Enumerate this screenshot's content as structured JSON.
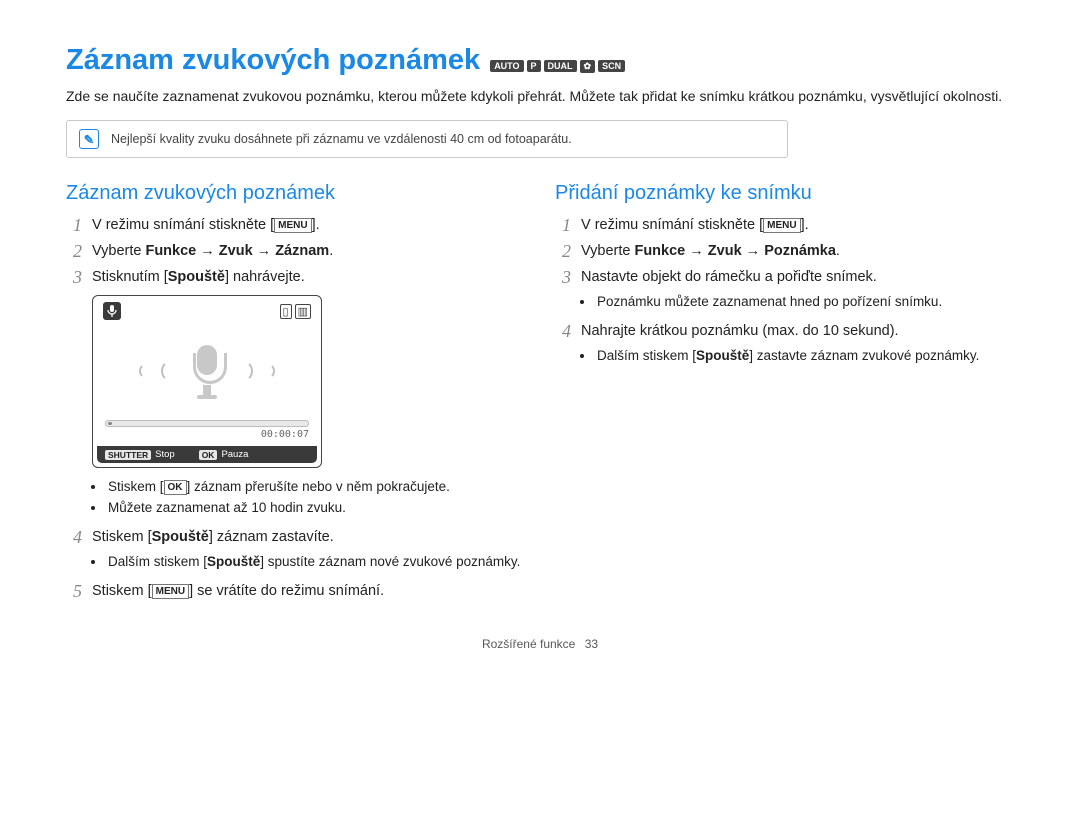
{
  "title": "Záznam zvukových poznámek",
  "mode_badges": [
    "AUTO",
    "P",
    "DUAL",
    "✿",
    "SCN"
  ],
  "intro": "Zde se naučíte zaznamenat zvukovou poznámku, kterou můžete kdykoli přehrát. Můžete tak přidat ke snímku krátkou poznámku, vysvětlující okolnosti.",
  "callout_icon_glyph": "✎",
  "callout_text": "Nejlepší kvality zvuku dosáhnete při záznamu ve vzdálenosti 40 cm od fotoaparátu.",
  "left": {
    "heading": "Záznam zvukových poznámek",
    "step1_a": "V režimu snímání stiskněte [",
    "step1_btn": "MENU",
    "step1_b": "].",
    "step2_a": "Vyberte ",
    "step2_b": "Funkce → Zvuk → Záznam",
    "step2_c": ".",
    "step3_a": "Stisknutím [",
    "step3_b": "Spouště",
    "step3_c": "] nahrávejte.",
    "recorder": {
      "time": "00:00:07",
      "shutter_label": "SHUTTER",
      "shutter_text": "Stop",
      "ok_label": "OK",
      "ok_text": "Pauza"
    },
    "bullets3": {
      "b1_a": "Stiskem [",
      "b1_btn": "OK",
      "b1_b": "] záznam přerušíte nebo v něm pokračujete.",
      "b2": "Můžete zaznamenat až 10 hodin zvuku."
    },
    "step4_a": "Stiskem [",
    "step4_b": "Spouště",
    "step4_c": "] záznam zastavíte.",
    "bullets4": {
      "b1_a": "Dalším stiskem [",
      "b1_b": "Spouště",
      "b1_c": "] spustíte záznam nové zvukové poznámky."
    },
    "step5_a": "Stiskem [",
    "step5_btn": "MENU",
    "step5_b": "] se vrátíte do režimu snímání."
  },
  "right": {
    "heading": "Přidání poznámky ke snímku",
    "step1_a": "V režimu snímání stiskněte [",
    "step1_btn": "MENU",
    "step1_b": "].",
    "step2_a": "Vyberte ",
    "step2_b": "Funkce → Zvuk → Poznámka",
    "step2_c": ".",
    "step3": "Nastavte objekt do rámečku a pořiďte snímek.",
    "bullets3": {
      "b1": "Poznámku můžete zaznamenat hned po pořízení snímku."
    },
    "step4": "Nahrajte krátkou poznámku (max. do 10 sekund).",
    "bullets4": {
      "b1_a": "Dalším stiskem [",
      "b1_b": "Spouště",
      "b1_c": "] zastavte záznam zvukové poznámky."
    }
  },
  "footer": {
    "section": "Rozšířené funkce",
    "page": "33"
  }
}
